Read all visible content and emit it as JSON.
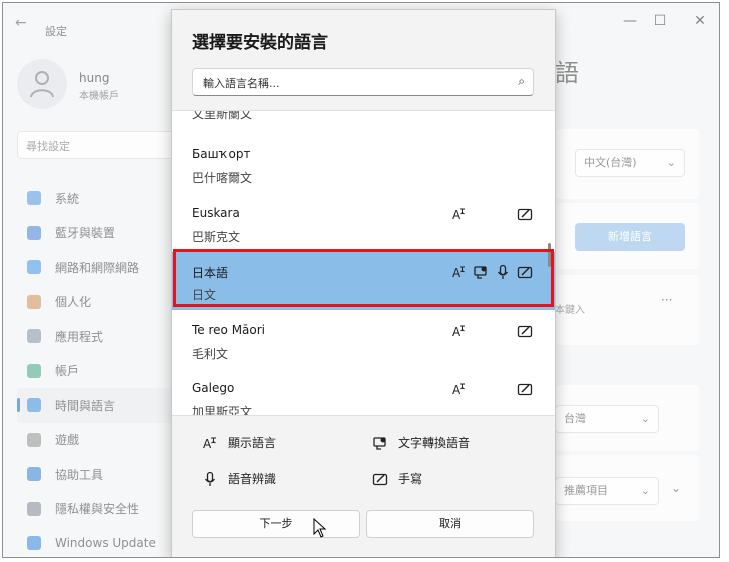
{
  "app": {
    "title": "設定",
    "user_name": "hung",
    "user_sub": "本機帳戶",
    "search_placeholder": "尋找設定",
    "page_heading": "語",
    "nav": [
      {
        "label": "系統",
        "color": "#4a90d9"
      },
      {
        "label": "藍牙與裝置",
        "color": "#3a7bd5"
      },
      {
        "label": "網路和網際網路",
        "color": "#3a8ee6"
      },
      {
        "label": "個人化",
        "color": "#c98a4b"
      },
      {
        "label": "應用程式",
        "color": "#7a8aa0"
      },
      {
        "label": "帳戶",
        "color": "#3aa17a"
      },
      {
        "label": "時間與語言",
        "color": "#2f87d6"
      },
      {
        "label": "遊戲",
        "color": "#8a8a8a"
      },
      {
        "label": "協助工具",
        "color": "#2b7bd0"
      },
      {
        "label": "隱私權與安全性",
        "color": "#7a8290"
      },
      {
        "label": "Windows Update",
        "color": "#2d7fd3"
      }
    ],
    "right": {
      "dropdown_lang": "中文(台灣)",
      "add_language_btn": "新增語言",
      "more": "···",
      "default_text": "本鍵入",
      "dropdown_region": "台灣",
      "dropdown_recommended": "推薦項目"
    },
    "window_controls": {
      "minimize": "—",
      "maximize": "☐",
      "close": "✕"
    }
  },
  "dialog": {
    "title": "選擇要安裝的語言",
    "search_value": "輸入語言名稱...",
    "partial_row": "文里斯蘭文",
    "rows": [
      {
        "native": "Башҡорт",
        "name": "巴什喀爾文",
        "icons": []
      },
      {
        "native": "Euskara",
        "name": "巴斯克文",
        "icons": [
          "display-language-icon",
          "handwriting-icon"
        ]
      },
      {
        "native": "日本語",
        "name": "日文",
        "icons": [
          "display-language-icon",
          "text-to-speech-icon",
          "speech-recognition-icon",
          "handwriting-icon"
        ],
        "selected": true
      },
      {
        "native": "Te reo Māori",
        "name": "毛利文",
        "icons": [
          "display-language-icon",
          "handwriting-icon"
        ]
      },
      {
        "native": "Galego",
        "name": "加里斯亞文",
        "icons": [
          "display-language-icon",
          "handwriting-icon"
        ]
      }
    ],
    "legend": {
      "display_language": "顯示語言",
      "text_to_speech": "文字轉換語音",
      "speech_recognition": "語音辨識",
      "handwriting": "手寫"
    },
    "next_button": "下一步",
    "cancel_button": "取消"
  }
}
